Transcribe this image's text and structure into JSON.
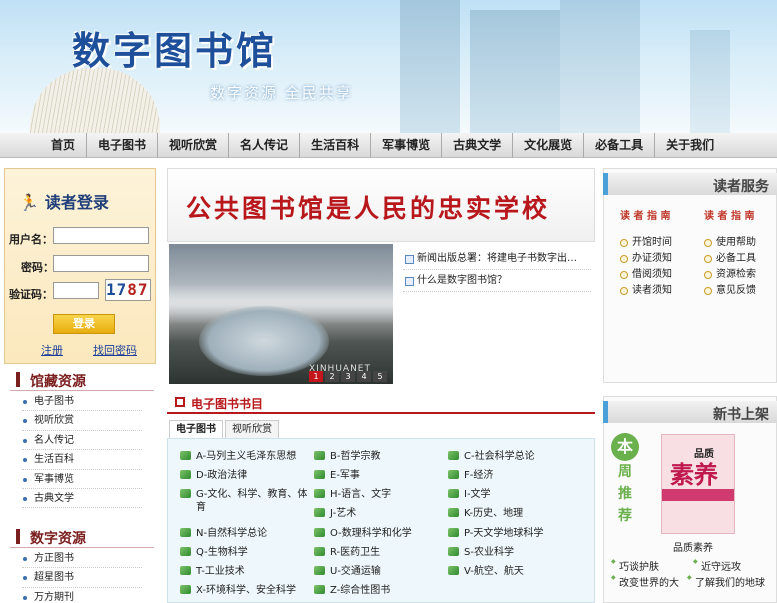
{
  "header": {
    "title": "数字图书馆",
    "slogan": "数字资源  全民共享"
  },
  "nav": [
    "首页",
    "电子图书",
    "视听欣赏",
    "名人传记",
    "生活百科",
    "军事博览",
    "古典文学",
    "文化展览",
    "必备工具",
    "关于我们"
  ],
  "login": {
    "title": "读者登录",
    "username_label": "用户名：",
    "password_label": "密码：",
    "captcha_label": "验证码：",
    "captcha_a": "17",
    "captcha_b": "87",
    "submit": "登录",
    "register": "注册",
    "forgot": "找回密码"
  },
  "collection": {
    "title": "馆藏资源",
    "items": [
      "电子图书",
      "视听欣赏",
      "名人传记",
      "生活百科",
      "军事博览",
      "古典文学"
    ]
  },
  "digital": {
    "title": "数字资源",
    "items": [
      "方正图书",
      "超星图书",
      "万方期刊"
    ]
  },
  "headline": "公共图书馆是人民的忠实学校",
  "slideshow": {
    "pages": [
      "1",
      "2",
      "3",
      "4",
      "5"
    ],
    "active": 0,
    "watermark": "XINHUANET"
  },
  "news": [
    "新闻出版总署：将建电子书数字出…",
    "什么是数字图书馆？"
  ],
  "ebook": {
    "title": "电子图书书目",
    "tabs": [
      "电子图书",
      "视听欣赏"
    ],
    "categories": [
      [
        "A-马列主义毛泽东思想",
        "B-哲学宗教",
        "C-社会科学总论"
      ],
      [
        "D-政治法律",
        "E-军事",
        "F-经济"
      ],
      [
        "G-文化、科学、教育、体育",
        "H-语言、文字",
        "I-文学"
      ],
      [
        "",
        "J-艺术",
        "K-历史、地理"
      ],
      [
        "N-自然科学总论",
        "O-数理科学和化学",
        "P-天文学地球科学"
      ],
      [
        "Q-生物科学",
        "R-医药卫生",
        "S-农业科学"
      ],
      [
        "T-工业技术",
        "U-交通运输",
        "V-航空、航天"
      ],
      [
        "X-环境科学、安全科学",
        "Z-综合性图书",
        ""
      ]
    ]
  },
  "service": {
    "title": "读者服务",
    "guide_label": "读 者 指 南",
    "col1": [
      "开馆时间",
      "办证须知",
      "借阅须知",
      "读者须知"
    ],
    "col2": [
      "使用帮助",
      "必备工具",
      "资源检索",
      "意见反馈"
    ]
  },
  "newbooks": {
    "title": "新书上架",
    "badge": "本",
    "vertical": [
      "周",
      "推",
      "荐"
    ],
    "cover_small": "品质",
    "cover_big": "素养",
    "book_name": "品质素养",
    "links": [
      "巧谈护肤",
      "近守远攻",
      "改变世界的大",
      "了解我们的地球"
    ]
  },
  "colors": {
    "accent_red": "#b8171c",
    "title_blue": "#1d4f9a",
    "side_red": "#7a1e1e",
    "green": "#6ab04c"
  }
}
